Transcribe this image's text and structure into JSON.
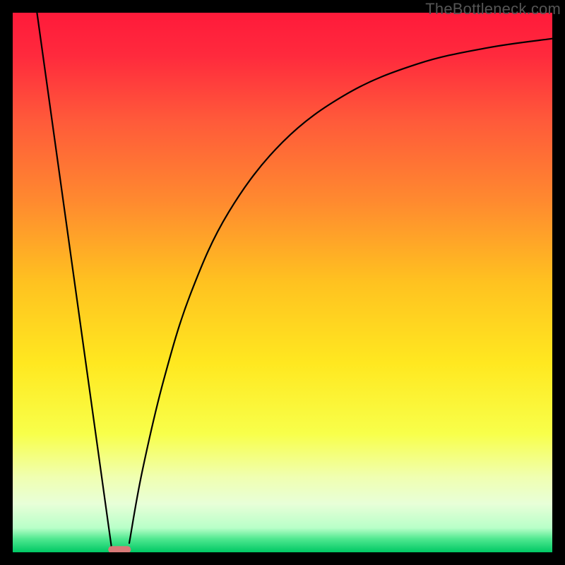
{
  "watermark": "TheBottleneck.com",
  "chart_data": {
    "type": "line",
    "title": "",
    "xlabel": "",
    "ylabel": "",
    "xlim": [
      0,
      100
    ],
    "ylim": [
      0,
      100
    ],
    "grid": false,
    "legend": false,
    "background": {
      "type": "vertical-gradient",
      "stops": [
        {
          "offset": 0.0,
          "color": "#ff1a3a"
        },
        {
          "offset": 0.08,
          "color": "#ff2a3d"
        },
        {
          "offset": 0.2,
          "color": "#ff5a3a"
        },
        {
          "offset": 0.35,
          "color": "#ff8a2f"
        },
        {
          "offset": 0.5,
          "color": "#ffc220"
        },
        {
          "offset": 0.65,
          "color": "#ffe820"
        },
        {
          "offset": 0.78,
          "color": "#f8ff4a"
        },
        {
          "offset": 0.86,
          "color": "#f0ffb0"
        },
        {
          "offset": 0.91,
          "color": "#e8ffd8"
        },
        {
          "offset": 0.955,
          "color": "#b8ffc8"
        },
        {
          "offset": 0.975,
          "color": "#50e890"
        },
        {
          "offset": 1.0,
          "color": "#00c864"
        }
      ]
    },
    "series": [
      {
        "name": "bottleneck-curve",
        "color": "#000000",
        "segments": [
          {
            "type": "line",
            "points": [
              {
                "x": 4.5,
                "y": 100
              },
              {
                "x": 18.3,
                "y": 1.0
              }
            ]
          },
          {
            "type": "curve",
            "points": [
              {
                "x": 21.6,
                "y": 1.7
              },
              {
                "x": 24,
                "y": 15
              },
              {
                "x": 28,
                "y": 32
              },
              {
                "x": 33,
                "y": 48
              },
              {
                "x": 40,
                "y": 63
              },
              {
                "x": 50,
                "y": 76
              },
              {
                "x": 62,
                "y": 85
              },
              {
                "x": 75,
                "y": 90.5
              },
              {
                "x": 88,
                "y": 93.5
              },
              {
                "x": 100,
                "y": 95.2
              }
            ]
          }
        ]
      }
    ],
    "marker": {
      "name": "optimal-region",
      "x_center": 19.8,
      "y": 0.5,
      "width": 4.2,
      "height": 1.3,
      "color": "#d87a78",
      "shape": "rounded-rect"
    }
  }
}
